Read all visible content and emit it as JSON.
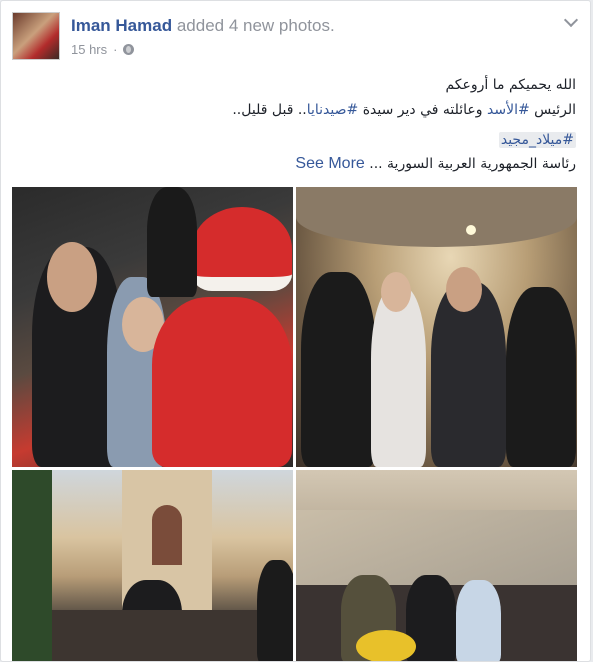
{
  "post": {
    "author": "Iman Hamad",
    "action": "added 4 new photos.",
    "timestamp": "15 hrs",
    "line1": "الله يحميكم ما أروعكم",
    "line2_pre": "الرئيس ",
    "line2_tag1": "#الأسد",
    "line2_mid": " وعائلته في دير سيدة ",
    "line2_tag2": "#صيدنايا",
    "line2_post": ".. قبل قليل..",
    "hashtag": "#ميلاد_مجيد",
    "line4": "رئاسة الجمهورية العربية السورية ...",
    "see_more": "See More"
  },
  "icons": {
    "privacy": "globe-icon",
    "menu": "chevron-down-icon"
  },
  "colors": {
    "link": "#365899",
    "muted": "#90949c",
    "text": "#1d2129"
  }
}
